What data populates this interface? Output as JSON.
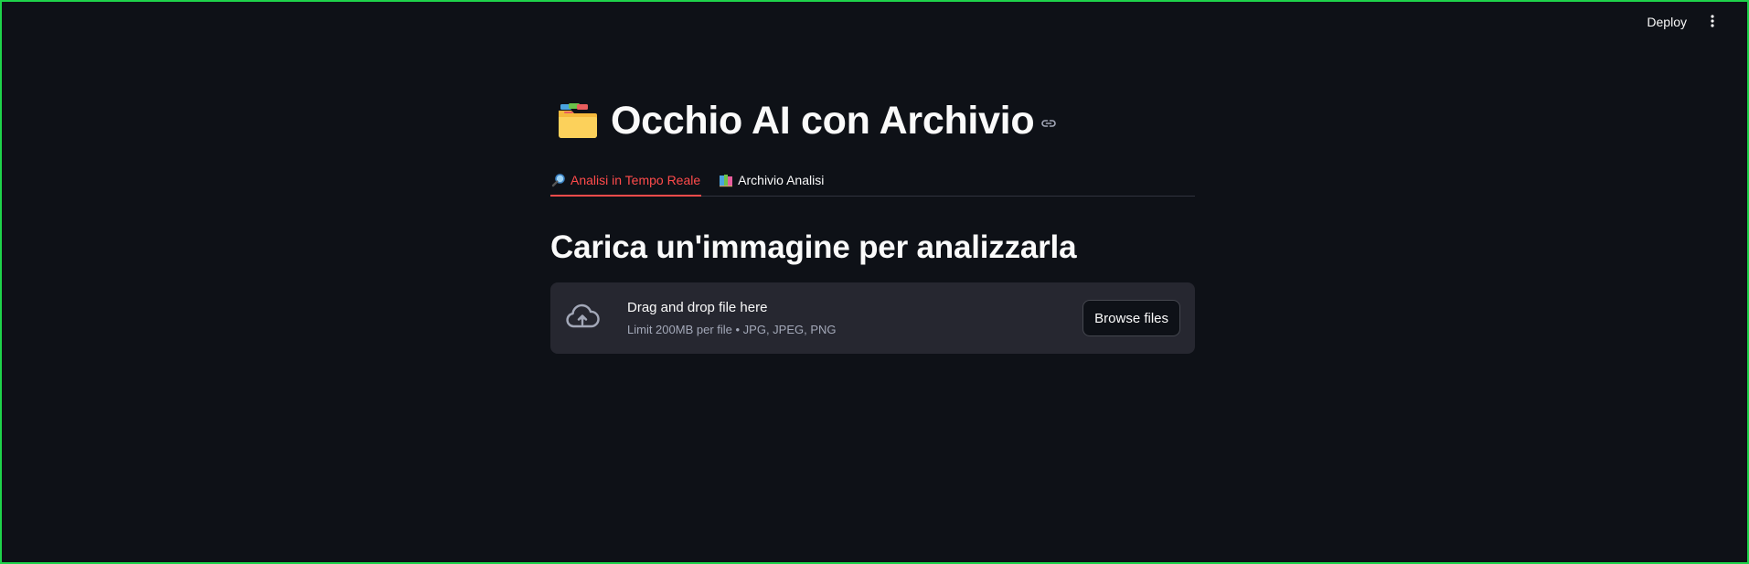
{
  "header": {
    "deploy_label": "Deploy",
    "menu_icon": "vertical-dots-icon"
  },
  "page": {
    "title_icon": "card-index-dividers-icon",
    "title": "Occhio AI con Archivio",
    "anchor_icon": "link-icon"
  },
  "tabs": [
    {
      "label": "Analisi in Tempo Reale",
      "icon": "magnifying-glass-icon",
      "active": true
    },
    {
      "label": "Archivio Analisi",
      "icon": "books-icon",
      "active": false
    }
  ],
  "section": {
    "heading": "Carica un'immagine per analizzarla"
  },
  "uploader": {
    "icon": "cloud-upload-icon",
    "title": "Drag and drop file here",
    "limit": "Limit 200MB per file • JPG, JPEG, PNG",
    "button_label": "Browse files"
  },
  "colors": {
    "background": "#0e1117",
    "accent": "#ff4b4b",
    "uploader_bg": "#262730",
    "frame_border": "#1ed24a"
  }
}
